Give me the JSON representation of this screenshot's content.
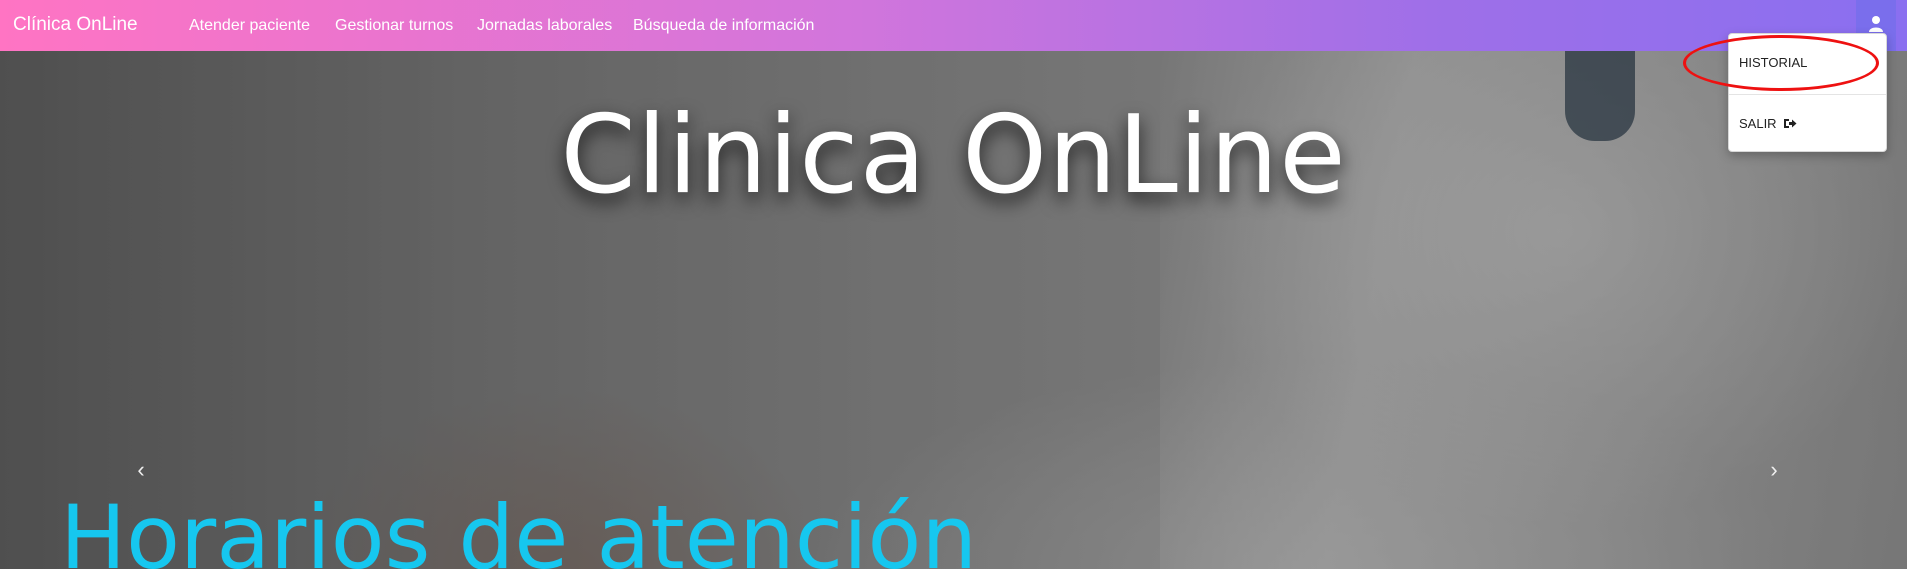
{
  "navbar": {
    "brand": "Clínica OnLine",
    "links": [
      "Atender paciente",
      "Gestionar turnos",
      "Jornadas laborales",
      "Búsqueda de información"
    ],
    "user_icon": "user-icon"
  },
  "dropdown": {
    "items": [
      {
        "label": "HISTORIAL"
      },
      {
        "label": "SALIR",
        "icon": "sign-out-icon"
      }
    ]
  },
  "hero": {
    "title": "Clinica OnLine",
    "subtitle": "Horarios de atención",
    "prev": "‹",
    "next": "›"
  },
  "colors": {
    "navbar_start": "#ff74c3",
    "navbar_end": "#8a6ff0",
    "subtitle": "#16c7ef",
    "annotation": "#e11111"
  }
}
